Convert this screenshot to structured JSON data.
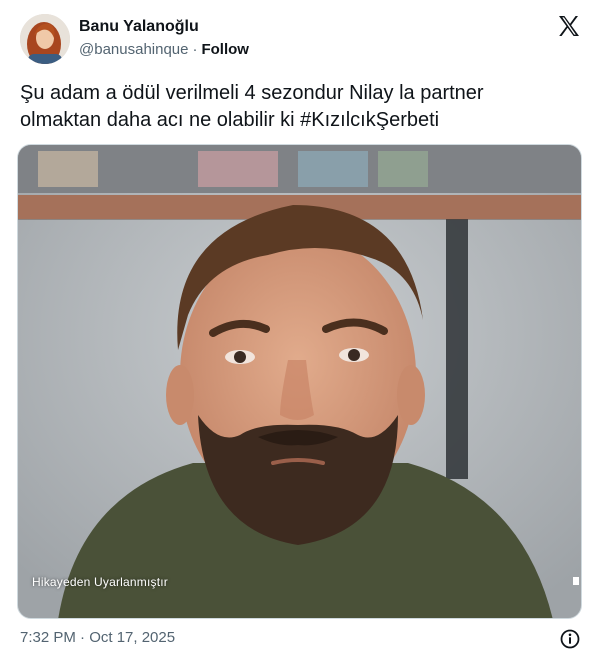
{
  "author": {
    "display_name": "Banu Yalanoğlu",
    "handle": "@banusahinque",
    "separator": "·",
    "follow_label": "Follow"
  },
  "platform_icon": "x-logo-icon",
  "tweet": {
    "text_line_1": "Şu adam a ödül verilmeli 4 sezondur Nilay la partner",
    "text_line_2": "olmaktan daha acı ne olabilir ki #KızılcıkŞerbeti",
    "media_caption": "Hikayeden Uyarlanmıştır",
    "timestamp": "7:32 PM · Oct 17, 2025"
  },
  "icons": {
    "info": "info-icon",
    "x": "x-logo-icon"
  },
  "colors": {
    "text_primary": "#0f1419",
    "text_secondary": "#536471",
    "border": "#cfd9de"
  }
}
